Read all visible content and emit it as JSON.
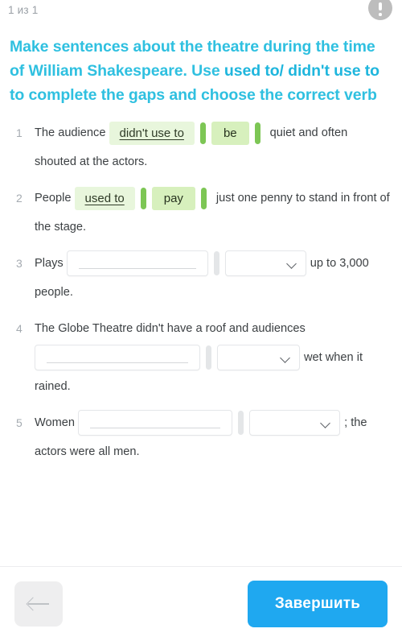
{
  "header": {
    "page_counter": "1 из 1",
    "alert_icon": "exclamation-circle-icon"
  },
  "title": {
    "part1": "Make sentences about the theatre during the time of William Shakespeare. Use ",
    "emphasis": "used to/ didn't use to",
    "part2": " to complete the gaps and choose the correct verb"
  },
  "questions": [
    {
      "number": "1",
      "lead": "The audience",
      "input_value": "didn't use to",
      "select_value": "be",
      "state": "filled",
      "tail": "quiet and often shouted at the actors."
    },
    {
      "number": "2",
      "lead": "People",
      "input_value": "used to",
      "select_value": "pay",
      "state": "filled",
      "tail": "just one penny to stand in front of the stage."
    },
    {
      "number": "3",
      "lead": "Plays",
      "input_value": "",
      "select_value": "",
      "state": "empty",
      "tail": "up to 3,000 people."
    },
    {
      "number": "4",
      "lead": "The Globe Theatre didn't have a roof and audiences",
      "input_value": "",
      "select_value": "",
      "state": "empty",
      "tail": "wet when it rained."
    },
    {
      "number": "5",
      "lead": "Women",
      "input_value": "",
      "select_value": "",
      "state": "empty",
      "tail": ";  the actors were all men."
    }
  ],
  "footer": {
    "back_label": "back-arrow-icon",
    "finish_label": "Завершить"
  },
  "colors": {
    "title": "#2fc0e0",
    "finish_button": "#1fa8f0",
    "filled_input_bg": "#e8f6dc",
    "filled_select_bg": "#d7f0bd",
    "green_bar": "#7dc655",
    "grey_bar": "#e4e6e8"
  }
}
